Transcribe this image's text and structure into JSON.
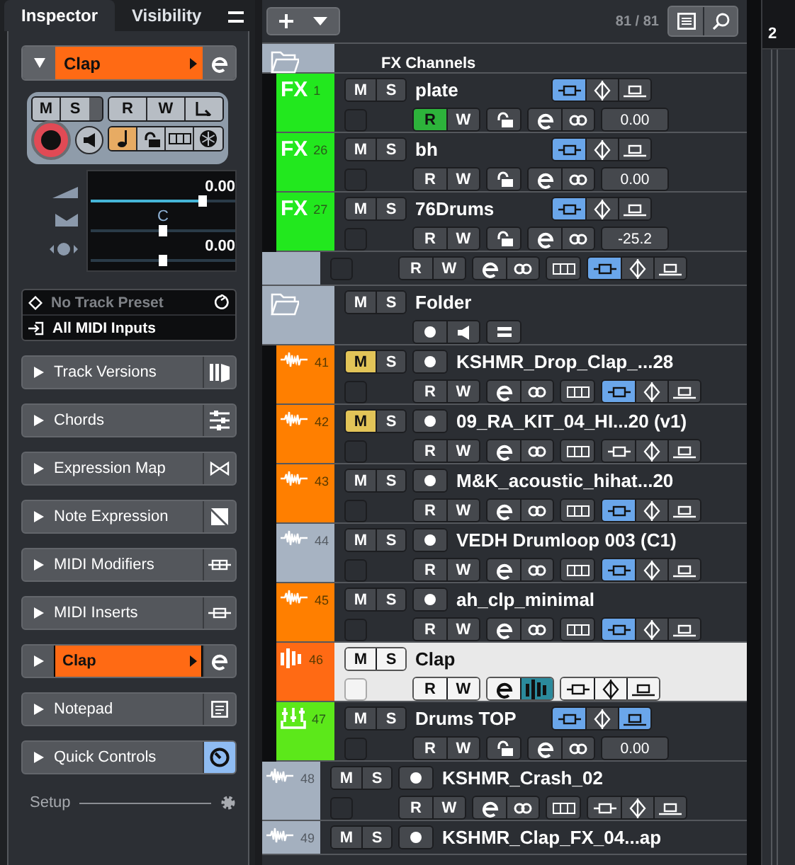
{
  "inspector": {
    "tabs": [
      {
        "label": "Inspector",
        "selected": true
      },
      {
        "label": "Visibility",
        "selected": false
      }
    ],
    "track": {
      "name": "Clap",
      "color": "#ff6a14"
    },
    "controls": {
      "mute": "M",
      "solo": "S",
      "read": "R",
      "write": "W",
      "musical_mode": true
    },
    "faders": [
      {
        "kind": "volume",
        "reading": "0.00",
        "level": 0.77
      },
      {
        "kind": "pan",
        "reading": "C",
        "level": 0.5
      },
      {
        "kind": "delay",
        "reading": "0.00",
        "level": 0.5
      }
    ],
    "preset": "No Track Preset",
    "input": "All MIDI Inputs",
    "sections": [
      {
        "kind": "versions",
        "label": "Track Versions",
        "on": false
      },
      {
        "kind": "chords",
        "label": "Chords",
        "on": false
      },
      {
        "kind": "expression",
        "label": "Expression Map",
        "on": false
      },
      {
        "kind": "note_expression",
        "label": "Note Expression",
        "on": false
      },
      {
        "kind": "modifiers",
        "label": "MIDI Modifiers",
        "on": false
      },
      {
        "kind": "inserts",
        "label": "MIDI Inserts",
        "on": false
      },
      {
        "kind": "instrument",
        "label": "Clap",
        "color": "#ff6a14",
        "on": false
      },
      {
        "kind": "notepad",
        "label": "Notepad",
        "on": false
      },
      {
        "kind": "quick",
        "label": "Quick Controls",
        "on": true
      }
    ],
    "setup": "Setup"
  },
  "toolbar": {
    "count": "81 / 81"
  },
  "ruler": {
    "label": "2"
  },
  "tracks": [
    {
      "kind": "fx_folder",
      "name": "FX Channels",
      "color": "#a4b0bf",
      "selected": false,
      "children": [
        {
          "kind": "fx",
          "type_label": "FX",
          "number": "1",
          "name": "plate",
          "color": "#22e81e",
          "selected": false,
          "mute": {
            "label": "M",
            "on": false
          },
          "solo": {
            "label": "S",
            "on": false
          },
          "read": {
            "label": "R",
            "on": true
          },
          "write": {
            "label": "W",
            "on": false
          },
          "value": "0.00",
          "modes": [
            {
              "selected": true
            },
            {
              "selected": false
            },
            {
              "selected": false
            }
          ]
        },
        {
          "kind": "fx",
          "type_label": "FX",
          "number": "26",
          "name": "bh",
          "color": "#22e81e",
          "selected": false,
          "mute": {
            "label": "M",
            "on": false
          },
          "solo": {
            "label": "S",
            "on": false
          },
          "read": {
            "label": "R",
            "on": false
          },
          "write": {
            "label": "W",
            "on": false
          },
          "value": "0.00",
          "modes": [
            {
              "selected": true
            },
            {
              "selected": false
            },
            {
              "selected": false
            }
          ]
        },
        {
          "kind": "fx",
          "type_label": "FX",
          "number": "27",
          "name": "76Drums",
          "color": "#22e81e",
          "selected": false,
          "mute": {
            "label": "M",
            "on": false
          },
          "solo": {
            "label": "S",
            "on": false
          },
          "read": {
            "label": "R",
            "on": false
          },
          "write": {
            "label": "W",
            "on": false
          },
          "value": "-25.2",
          "modes": [
            {
              "selected": true
            },
            {
              "selected": false
            },
            {
              "selected": false
            }
          ]
        }
      ]
    },
    {
      "kind": "audio_tail",
      "color": "#a4b0bf",
      "selected": false,
      "read": {
        "label": "R",
        "on": false
      },
      "write": {
        "label": "W",
        "on": false
      },
      "modes": [
        {
          "selected": true
        },
        {
          "selected": false
        },
        {
          "selected": false
        }
      ]
    },
    {
      "kind": "folder",
      "name": "Folder",
      "color": "#a4b0bf",
      "selected": false,
      "mute": {
        "label": "M",
        "on": false
      },
      "solo": {
        "label": "S",
        "on": false
      },
      "children": [
        {
          "kind": "audio",
          "number": "41",
          "name": "KSHMR_Drop_Clap_...28",
          "color": "#ff7f00",
          "selected": false,
          "mute": {
            "label": "M",
            "on": true
          },
          "solo": {
            "label": "S",
            "on": false
          },
          "read": {
            "label": "R",
            "on": false
          },
          "write": {
            "label": "W",
            "on": false
          },
          "modes": [
            {
              "selected": true
            },
            {
              "selected": false
            },
            {
              "selected": false
            }
          ]
        },
        {
          "kind": "audio",
          "number": "42",
          "name": "09_RA_KIT_04_HI...20 (v1)",
          "color": "#ff7f00",
          "selected": false,
          "mute": {
            "label": "M",
            "on": true
          },
          "solo": {
            "label": "S",
            "on": false
          },
          "read": {
            "label": "R",
            "on": false
          },
          "write": {
            "label": "W",
            "on": false
          },
          "modes": [
            {
              "selected": false
            },
            {
              "selected": false
            },
            {
              "selected": false
            }
          ]
        },
        {
          "kind": "audio",
          "number": "43",
          "name": "M&K_acoustic_hihat...20",
          "color": "#ff7f00",
          "selected": false,
          "mute": {
            "label": "M",
            "on": false
          },
          "solo": {
            "label": "S",
            "on": false
          },
          "read": {
            "label": "R",
            "on": false
          },
          "write": {
            "label": "W",
            "on": false
          },
          "modes": [
            {
              "selected": true
            },
            {
              "selected": false
            },
            {
              "selected": false
            }
          ]
        },
        {
          "kind": "audio",
          "number": "44",
          "name": "VEDH Drumloop 003  (C1)",
          "color": "#a7b3c2",
          "selected": false,
          "mute": {
            "label": "M",
            "on": false
          },
          "solo": {
            "label": "S",
            "on": false
          },
          "read": {
            "label": "R",
            "on": false
          },
          "write": {
            "label": "W",
            "on": false
          },
          "modes": [
            {
              "selected": true
            },
            {
              "selected": false
            },
            {
              "selected": false
            }
          ]
        },
        {
          "kind": "audio",
          "number": "45",
          "name": "ah_clp_minimal",
          "color": "#ff7f00",
          "selected": false,
          "mute": {
            "label": "M",
            "on": false
          },
          "solo": {
            "label": "S",
            "on": false
          },
          "read": {
            "label": "R",
            "on": false
          },
          "write": {
            "label": "W",
            "on": false
          },
          "modes": [
            {
              "selected": true
            },
            {
              "selected": false
            },
            {
              "selected": false
            }
          ]
        },
        {
          "kind": "instrument",
          "number": "46",
          "name": "Clap",
          "color": "#ff6a14",
          "selected": true,
          "mute": {
            "label": "M",
            "on": false
          },
          "solo": {
            "label": "S",
            "on": false
          },
          "read": {
            "label": "R",
            "on": false
          },
          "write": {
            "label": "W",
            "on": false
          },
          "meter_on": true,
          "modes": [
            {
              "selected": false
            },
            {
              "selected": false
            },
            {
              "selected": false
            }
          ]
        },
        {
          "kind": "group",
          "number": "47",
          "name": "Drums TOP",
          "color": "#5ce81a",
          "selected": false,
          "mute": {
            "label": "M",
            "on": false
          },
          "solo": {
            "label": "S",
            "on": false
          },
          "read": {
            "label": "R",
            "on": false
          },
          "write": {
            "label": "W",
            "on": false
          },
          "value": "0.00",
          "modes": [
            {
              "selected": true
            },
            {
              "selected": false
            },
            {
              "selected": true
            }
          ]
        }
      ]
    },
    {
      "kind": "audio",
      "number": "48",
      "name": "KSHMR_Crash_02",
      "color": "#a4b0bf",
      "selected": false,
      "mute": {
        "label": "M",
        "on": false
      },
      "solo": {
        "label": "S",
        "on": false
      },
      "read": {
        "label": "R",
        "on": false
      },
      "write": {
        "label": "W",
        "on": false
      },
      "modes": [
        {
          "selected": false
        },
        {
          "selected": false
        },
        {
          "selected": false
        }
      ]
    },
    {
      "kind": "audio",
      "number": "49",
      "name": "KSHMR_Clap_FX_04...ap",
      "color": "#a4b0bf",
      "selected": false,
      "mute": {
        "label": "M",
        "on": false
      },
      "solo": {
        "label": "S",
        "on": false
      }
    }
  ]
}
